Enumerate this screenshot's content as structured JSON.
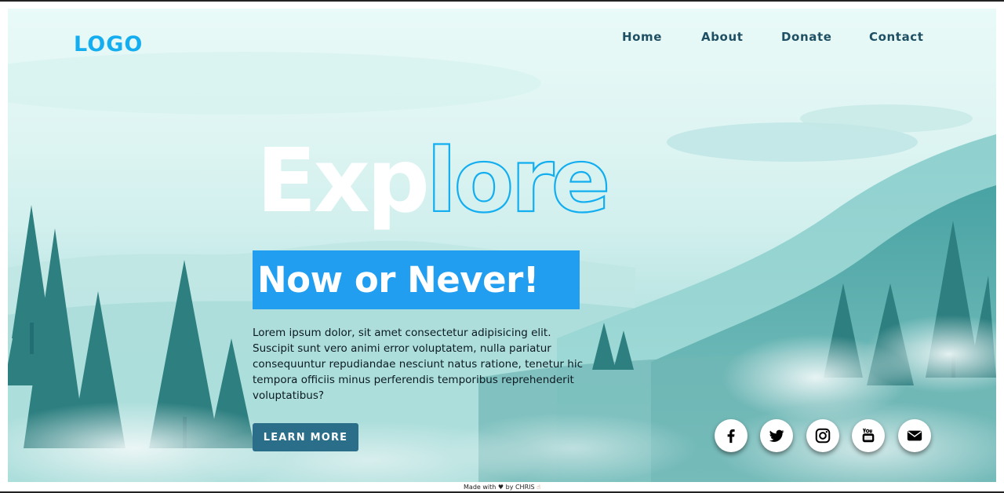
{
  "brand": {
    "logo": "LOGO",
    "accent": "#14aef0"
  },
  "nav": {
    "items": [
      "Home",
      "About",
      "Donate",
      "Contact"
    ]
  },
  "hero": {
    "headline": "Explore",
    "headline_solid_part": "Exp",
    "headline_outline_part": "lore",
    "tagline": "Now or Never!",
    "tagline_bg": "#229ef0",
    "description_lines": [
      "Lorem ipsum dolor, sit amet consectetur adipisicing elit.",
      "Suscipit sunt vero animi error voluptatem, nulla pariatur",
      "consequuntur repudiandae nesciunt natus ratione, tenetur hic",
      "tempora officiis minus perferendis temporibus reprehenderit",
      "voluptatibus?"
    ],
    "cta_label": "LEARN MORE",
    "cta_color": "#2a6e89"
  },
  "social": {
    "icons": [
      "facebook-icon",
      "twitter-icon",
      "instagram-icon",
      "youtube-icon",
      "email-icon"
    ]
  },
  "footer": {
    "made_with": "Made with",
    "by": "by CHRIS"
  }
}
